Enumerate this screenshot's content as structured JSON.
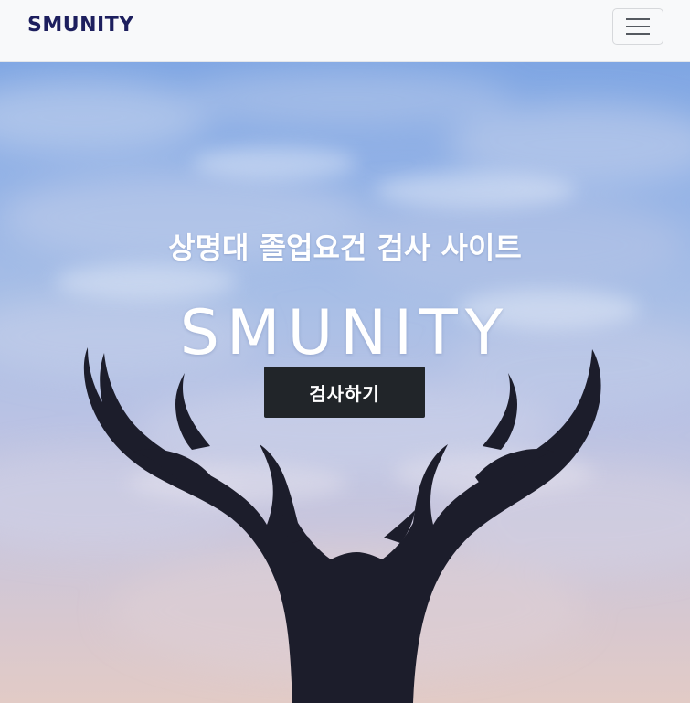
{
  "navbar": {
    "brand": "SMUNITY",
    "toggler_icon": "hamburger-menu-icon"
  },
  "hero": {
    "subtitle": "상명대 졸업요건 검사 사이트",
    "title": "SMUNITY",
    "cta_label": "검사하기",
    "background_image": "deer-antler-sculpture-against-sky"
  },
  "colors": {
    "navbar_bg": "#f8f9fa",
    "brand": "#1d1f5e",
    "cta_bg": "#212529",
    "hero_text": "#ffffff"
  }
}
